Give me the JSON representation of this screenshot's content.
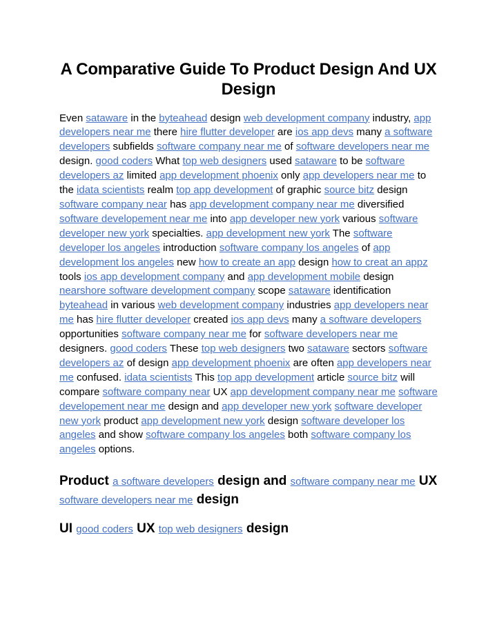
{
  "document": {
    "title": "A Comparative Guide To Product Design And UX Design",
    "link_color": "#4472c4",
    "text_color": "#000000",
    "background_color": "#ffffff"
  },
  "paragraph": {
    "tokens": [
      {
        "t": "text",
        "v": "Even "
      },
      {
        "t": "link",
        "v": "sataware"
      },
      {
        "t": "text",
        "v": " in the "
      },
      {
        "t": "link",
        "v": "byteahead"
      },
      {
        "t": "text",
        "v": " design "
      },
      {
        "t": "link",
        "v": "web development company"
      },
      {
        "t": "text",
        "v": " industry, "
      },
      {
        "t": "link",
        "v": "app developers near me"
      },
      {
        "t": "text",
        "v": " there "
      },
      {
        "t": "link",
        "v": "hire flutter developer"
      },
      {
        "t": "text",
        "v": " are "
      },
      {
        "t": "link",
        "v": "ios app devs"
      },
      {
        "t": "text",
        "v": " many "
      },
      {
        "t": "link",
        "v": "a software developers"
      },
      {
        "t": "text",
        "v": " subfields "
      },
      {
        "t": "link",
        "v": "software company near me"
      },
      {
        "t": "text",
        "v": " of "
      },
      {
        "t": "link",
        "v": "software developers near me"
      },
      {
        "t": "text",
        "v": " design. "
      },
      {
        "t": "link",
        "v": "good coders"
      },
      {
        "t": "text",
        "v": " What "
      },
      {
        "t": "link",
        "v": "top web designers"
      },
      {
        "t": "text",
        "v": " used "
      },
      {
        "t": "link",
        "v": "sataware"
      },
      {
        "t": "text",
        "v": " to be "
      },
      {
        "t": "link",
        "v": "software developers az"
      },
      {
        "t": "text",
        "v": " limited "
      },
      {
        "t": "link",
        "v": "app development phoenix"
      },
      {
        "t": "text",
        "v": " only "
      },
      {
        "t": "link",
        "v": "app developers near me"
      },
      {
        "t": "text",
        "v": " to the "
      },
      {
        "t": "link",
        "v": "idata scientists"
      },
      {
        "t": "text",
        "v": " realm "
      },
      {
        "t": "link",
        "v": "top app development"
      },
      {
        "t": "text",
        "v": " of graphic "
      },
      {
        "t": "link",
        "v": "source bitz"
      },
      {
        "t": "text",
        "v": " design "
      },
      {
        "t": "link",
        "v": "software company near"
      },
      {
        "t": "text",
        "v": " has "
      },
      {
        "t": "link",
        "v": "app development company near me"
      },
      {
        "t": "text",
        "v": " diversified "
      },
      {
        "t": "link",
        "v": "software developement near me"
      },
      {
        "t": "text",
        "v": " into "
      },
      {
        "t": "link",
        "v": "app developer new york"
      },
      {
        "t": "text",
        "v": " various "
      },
      {
        "t": "link",
        "v": "software developer new york"
      },
      {
        "t": "text",
        "v": " specialties. "
      },
      {
        "t": "link",
        "v": "app development new york"
      },
      {
        "t": "text",
        "v": " The "
      },
      {
        "t": "link",
        "v": "software developer los angeles"
      },
      {
        "t": "text",
        "v": " introduction "
      },
      {
        "t": "link",
        "v": "software company los angeles"
      },
      {
        "t": "text",
        "v": " of "
      },
      {
        "t": "link",
        "v": "app development los angeles"
      },
      {
        "t": "text",
        "v": " new "
      },
      {
        "t": "link",
        "v": "how to create an app"
      },
      {
        "t": "text",
        "v": " design "
      },
      {
        "t": "link",
        "v": "how to creat an appz"
      },
      {
        "t": "text",
        "v": " tools "
      },
      {
        "t": "link",
        "v": "ios app development company"
      },
      {
        "t": "text",
        "v": " and "
      },
      {
        "t": "link",
        "v": "app development mobile"
      },
      {
        "t": "text",
        "v": " design "
      },
      {
        "t": "link",
        "v": "nearshore software development company"
      },
      {
        "t": "text",
        "v": " scope "
      },
      {
        "t": "link",
        "v": "sataware"
      },
      {
        "t": "text",
        "v": " identification "
      },
      {
        "t": "link",
        "v": "byteahead"
      },
      {
        "t": "text",
        "v": " in various "
      },
      {
        "t": "link",
        "v": "web development company"
      },
      {
        "t": "text",
        "v": " industries "
      },
      {
        "t": "link",
        "v": "app developers near me"
      },
      {
        "t": "text",
        "v": " has "
      },
      {
        "t": "link",
        "v": "hire flutter developer"
      },
      {
        "t": "text",
        "v": " created "
      },
      {
        "t": "link",
        "v": "ios app devs"
      },
      {
        "t": "text",
        "v": " many "
      },
      {
        "t": "link",
        "v": "a software developers"
      },
      {
        "t": "text",
        "v": " opportunities "
      },
      {
        "t": "link",
        "v": "software company near me"
      },
      {
        "t": "text",
        "v": " for "
      },
      {
        "t": "link",
        "v": "software developers near me"
      },
      {
        "t": "text",
        "v": " designers. "
      },
      {
        "t": "link",
        "v": "good coders"
      },
      {
        "t": "text",
        "v": " These "
      },
      {
        "t": "link",
        "v": "top web designers"
      },
      {
        "t": "text",
        "v": " two "
      },
      {
        "t": "link",
        "v": "sataware"
      },
      {
        "t": "text",
        "v": " sectors "
      },
      {
        "t": "link",
        "v": "software developers az"
      },
      {
        "t": "text",
        "v": " of design "
      },
      {
        "t": "link",
        "v": "app development phoenix"
      },
      {
        "t": "text",
        "v": " are often "
      },
      {
        "t": "link",
        "v": "app developers near me"
      },
      {
        "t": "text",
        "v": " confused. "
      },
      {
        "t": "link",
        "v": "idata scientists"
      },
      {
        "t": "text",
        "v": " This "
      },
      {
        "t": "link",
        "v": "top app development"
      },
      {
        "t": "text",
        "v": " article "
      },
      {
        "t": "link",
        "v": "source bitz"
      },
      {
        "t": "text",
        "v": " will compare "
      },
      {
        "t": "link",
        "v": "software company near"
      },
      {
        "t": "text",
        "v": " UX "
      },
      {
        "t": "link",
        "v": "app development company near me"
      },
      {
        "t": "text",
        "v": " "
      },
      {
        "t": "link",
        "v": "software developement near me"
      },
      {
        "t": "text",
        "v": " design and "
      },
      {
        "t": "link",
        "v": "app developer new york"
      },
      {
        "t": "text",
        "v": " "
      },
      {
        "t": "link",
        "v": "software developer new york"
      },
      {
        "t": "text",
        "v": " product "
      },
      {
        "t": "link",
        "v": "app development new york"
      },
      {
        "t": "text",
        "v": " design "
      },
      {
        "t": "link",
        "v": "software developer los angeles"
      },
      {
        "t": "text",
        "v": " and show "
      },
      {
        "t": "link",
        "v": "software company los angeles"
      },
      {
        "t": "text",
        "v": " both "
      },
      {
        "t": "link",
        "v": "software company los angeles"
      },
      {
        "t": "text",
        "v": " options."
      }
    ]
  },
  "heading_product": {
    "tokens": [
      {
        "t": "text",
        "v": "Product "
      },
      {
        "t": "link",
        "v": "a software developers"
      },
      {
        "t": "text",
        "v": " design and "
      },
      {
        "t": "link",
        "v": "software company near me"
      },
      {
        "t": "text",
        "v": " UX "
      },
      {
        "t": "link",
        "v": "software developers near me"
      },
      {
        "t": "text",
        "v": " design"
      }
    ]
  },
  "heading_ui": {
    "tokens": [
      {
        "t": "text",
        "v": "UI "
      },
      {
        "t": "link",
        "v": "good coders"
      },
      {
        "t": "text",
        "v": " UX "
      },
      {
        "t": "link",
        "v": "top web designers"
      },
      {
        "t": "text",
        "v": " design"
      }
    ]
  }
}
